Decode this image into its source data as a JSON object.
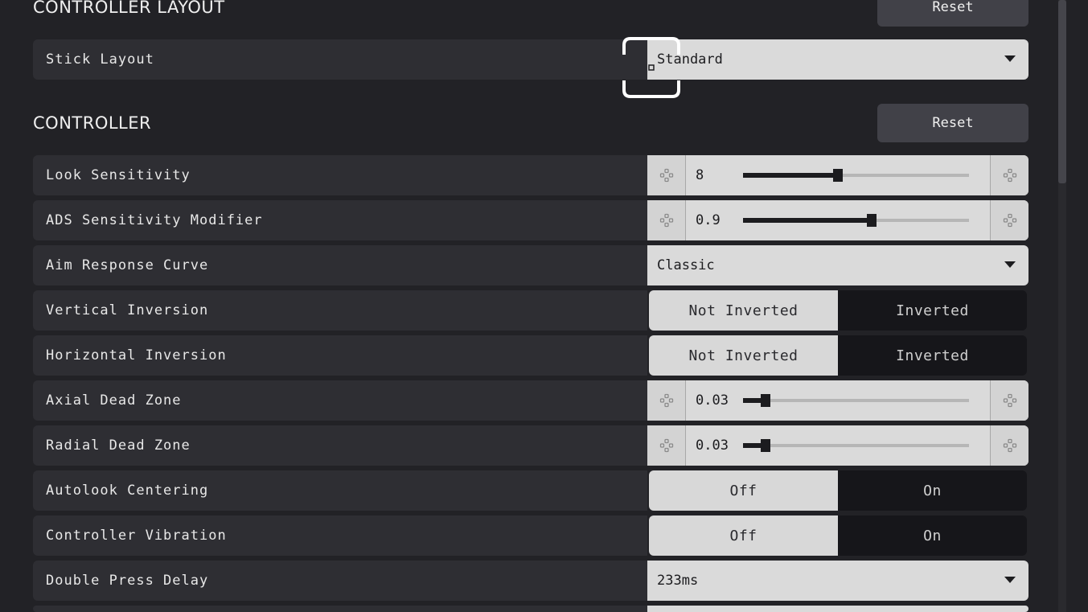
{
  "sections": {
    "layout": {
      "title": "CONTROLLER LAYOUT",
      "reset_label": "Reset"
    },
    "controller": {
      "title": "CONTROLLER",
      "reset_label": "Reset"
    }
  },
  "stick_layout": {
    "label": "Stick Layout",
    "value": "Standard"
  },
  "settings": {
    "look_sensitivity": {
      "label": "Look Sensitivity",
      "value": "8",
      "level": 0.42
    },
    "ads_modifier": {
      "label": "ADS Sensitivity Modifier",
      "value": "0.9",
      "level": 0.57
    },
    "aim_curve": {
      "label": "Aim Response Curve",
      "value": "Classic"
    },
    "vertical_inversion": {
      "label": "Vertical Inversion",
      "option_a": "Not Inverted",
      "option_b": "Inverted",
      "selected": "option_a"
    },
    "horizontal_inversion": {
      "label": "Horizontal Inversion",
      "option_a": "Not Inverted",
      "option_b": "Inverted",
      "selected": "option_a"
    },
    "axial_dead_zone": {
      "label": "Axial Dead Zone",
      "value": "0.03",
      "level": 0.1
    },
    "radial_dead_zone": {
      "label": "Radial Dead Zone",
      "value": "0.03",
      "level": 0.1
    },
    "autolook_centering": {
      "label": "Autolook Centering",
      "option_a": "Off",
      "option_b": "On",
      "selected": "option_a"
    },
    "controller_vibration": {
      "label": "Controller Vibration",
      "option_a": "Off",
      "option_b": "On",
      "selected": "option_a"
    },
    "double_press_delay": {
      "label": "Double Press Delay",
      "value": "233ms"
    }
  },
  "icons": {
    "decrease": "gamepad-dpad-icon",
    "increase": "gamepad-dpad-icon",
    "dropdown": "caret-down-icon"
  },
  "colors": {
    "background": "#222226",
    "row": "#2e2e33",
    "control_light": "#dadada",
    "toggle_dark": "#16161a"
  }
}
